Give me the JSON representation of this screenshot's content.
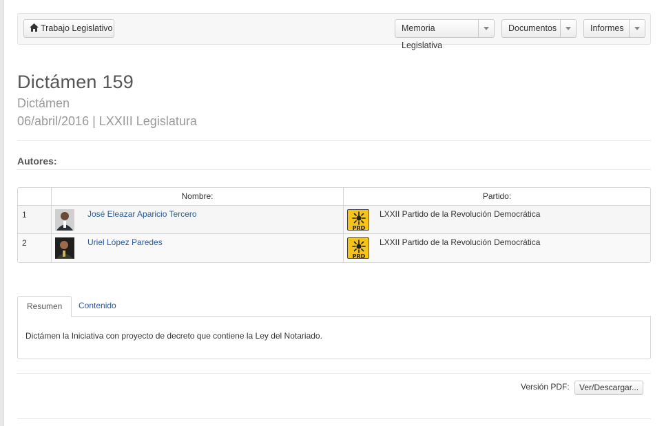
{
  "navbar": {
    "home_label": "Trabajo Legislativo",
    "menus": [
      {
        "label": "Memoria Legislativa"
      },
      {
        "label": "Documentos"
      },
      {
        "label": "Informes"
      }
    ]
  },
  "header": {
    "title": "Dictámen 159",
    "subtitle": "Dictámen",
    "date_line": "06/abril/2016 | LXXIII Legislatura"
  },
  "authors": {
    "heading": "Autores:",
    "columns": {
      "number": "",
      "name": "Nombre:",
      "party": "Partido:"
    },
    "rows": [
      {
        "number": "1",
        "name": "José Eleazar Aparicio Tercero",
        "party_logo_text": "PRD",
        "party": "LXXII Partido de la Revolución Democrática"
      },
      {
        "number": "2",
        "name": "Uriel López Paredes",
        "party_logo_text": "PRD",
        "party": "LXXII Partido de la Revolución Democrática"
      }
    ]
  },
  "tabs": [
    {
      "label": "Resumen",
      "active": true
    },
    {
      "label": "Contenido",
      "active": false
    }
  ],
  "summary_text": "Dictámen la Iniciativa con proyecto de decreto que contiene la Ley del Notariado.",
  "pdf": {
    "label": "Versión PDF:",
    "button": "Ver/Descargar..."
  },
  "colors": {
    "link": "#2a5a9a",
    "prd_yellow": "#f6c31a"
  }
}
